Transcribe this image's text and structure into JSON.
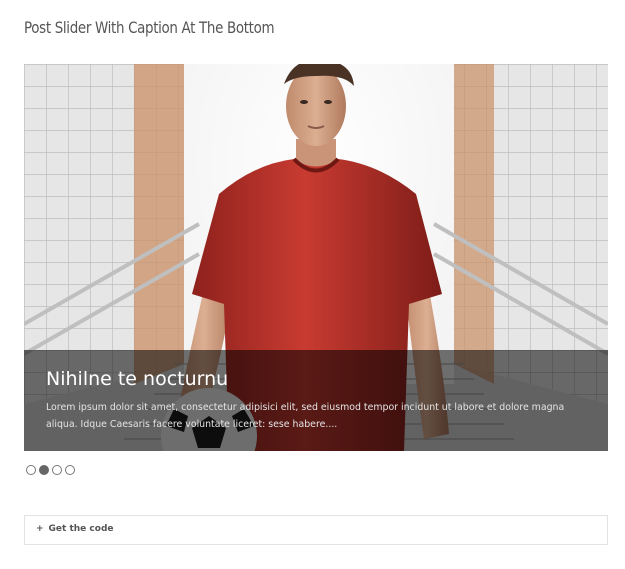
{
  "page": {
    "title": "Post Slider With Caption At The Bottom"
  },
  "slider": {
    "slide": {
      "image_alt": "Young man in red football shirt holding a soccer ball on stairs",
      "caption_title": "Nihilne te nocturnu",
      "caption_text": "Lorem ipsum dolor sit amet, consectetur adipisici elit, sed eiusmod tempor incidunt ut labore et dolore magna aliqua. Idque Caesaris facere voluntate liceret: sese habere...."
    },
    "pagination": {
      "count": 4,
      "active_index": 1
    }
  },
  "code_toggle": {
    "icon": "plus-icon",
    "symbol": "+",
    "label": "Get the code"
  },
  "colors": {
    "caption_bg": "rgba(0,0,0,0.55)",
    "shirt_red": "#b3302a",
    "dot_active": "#666666"
  }
}
